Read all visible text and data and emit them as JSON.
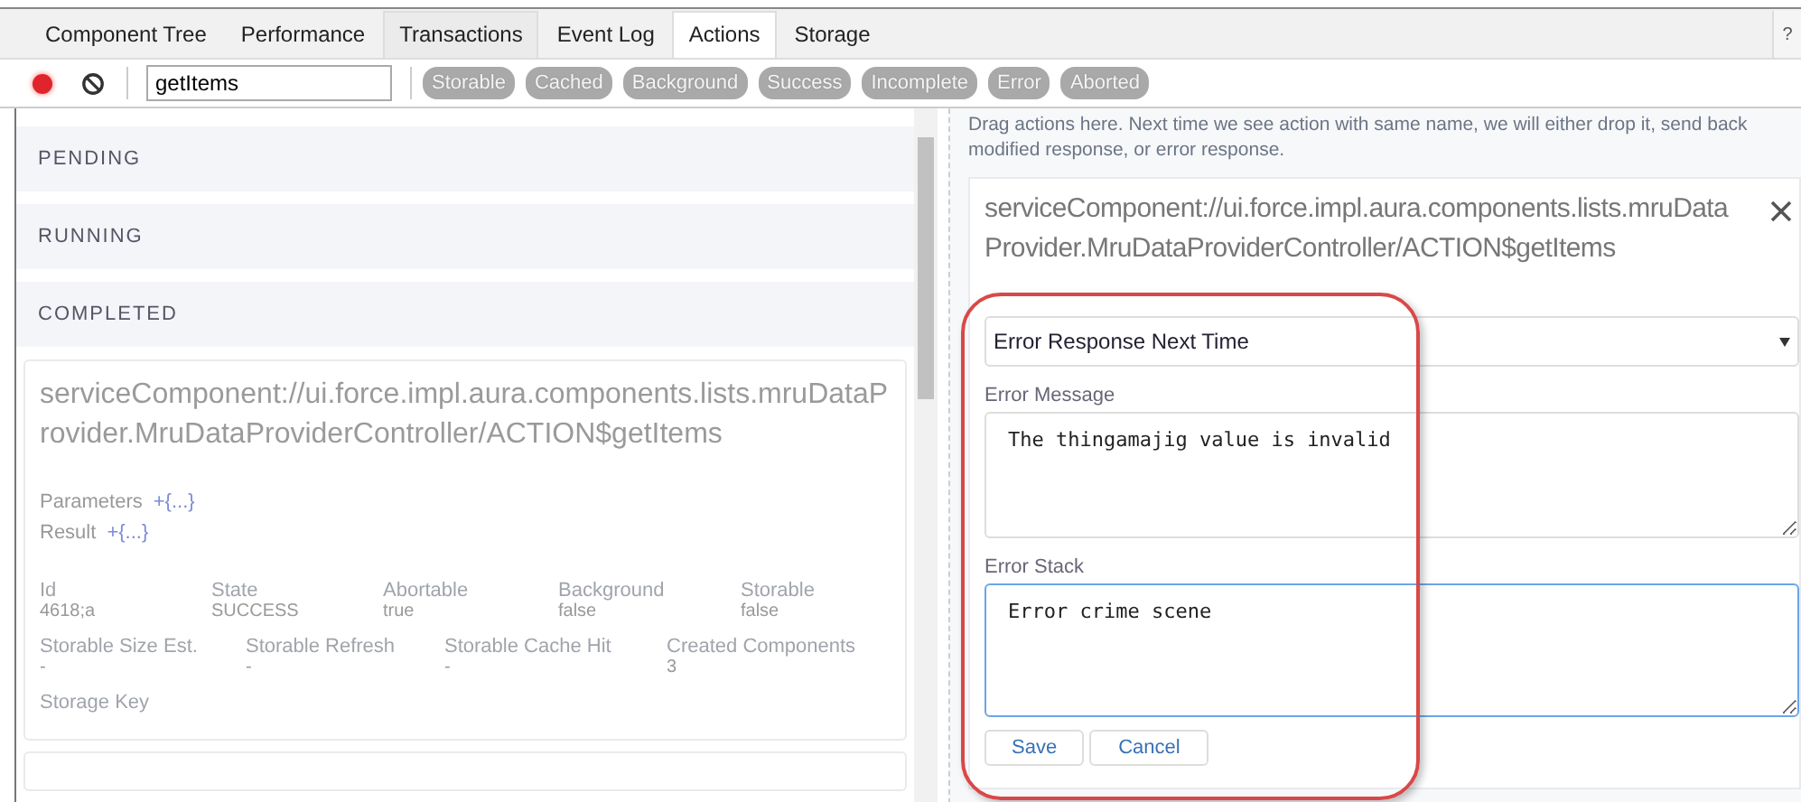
{
  "tabs": [
    {
      "label": "Component Tree",
      "selected": false,
      "hovered": false
    },
    {
      "label": "Performance",
      "selected": false,
      "hovered": false
    },
    {
      "label": "Transactions",
      "selected": false,
      "hovered": true
    },
    {
      "label": "Event Log",
      "selected": false,
      "hovered": false
    },
    {
      "label": "Actions",
      "selected": true,
      "hovered": false
    },
    {
      "label": "Storage",
      "selected": false,
      "hovered": false
    }
  ],
  "help": "?",
  "toolbar": {
    "recording": true,
    "filter": "getItems",
    "chips": [
      {
        "label": "Storable",
        "on": false
      },
      {
        "label": "Cached",
        "on": false
      },
      {
        "label": "Background",
        "on": false
      },
      {
        "label": "Success",
        "on": false
      },
      {
        "label": "Incomplete",
        "on": false
      },
      {
        "label": "Error",
        "on": false
      },
      {
        "label": "Aborted",
        "on": false
      }
    ]
  },
  "sections": [
    "PENDING",
    "RUNNING",
    "COMPLETED"
  ],
  "action": {
    "name": "serviceComponent://ui.force.impl.aura.components.lists.mruDataProvider.MruDataProviderController/ACTION$getItems",
    "expanders": [
      {
        "label": "Parameters",
        "value": "+{...}"
      },
      {
        "label": "Result",
        "value": "+{...}"
      }
    ],
    "fields": [
      {
        "label": "Id",
        "value": "4618;a"
      },
      {
        "label": "State",
        "value": "SUCCESS"
      },
      {
        "label": "Abortable",
        "value": "true"
      },
      {
        "label": "Background",
        "value": "false"
      },
      {
        "label": "Storable",
        "value": "false"
      }
    ],
    "fields2": [
      {
        "label": "Storable Size Est.",
        "value": "-"
      },
      {
        "label": "Storable Refresh",
        "value": "-"
      },
      {
        "label": "Storable Cache Hit",
        "value": "-"
      },
      {
        "label": "Created Components",
        "value": "3"
      }
    ],
    "storage_key": "Storage Key"
  },
  "drop_zone": {
    "hint": "Drag actions here. Next time we see action with same name, we will either drop it, send back modified response, or error response.",
    "card": {
      "name": "serviceComponent://ui.force.impl.aura.components.lists.mruDataProvider.MruDataProviderController/ACTION$getItems",
      "mode": "Error Response Next Time",
      "message_label": "Error Message",
      "message": "The thingamajig value is invalid",
      "stack_label": "Error Stack",
      "stack": "Error crime scene",
      "buttons": [
        "Save",
        "Cancel"
      ]
    }
  }
}
